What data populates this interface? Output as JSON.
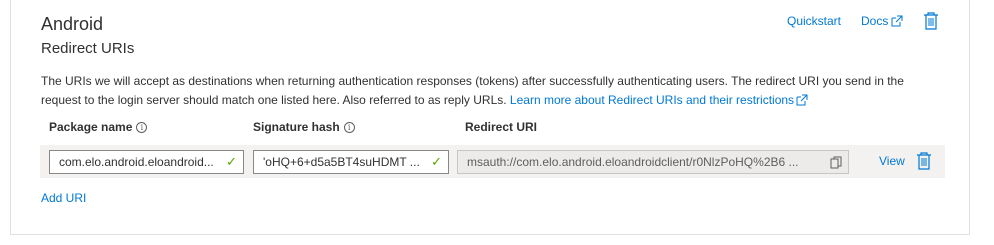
{
  "platform": {
    "title": "Android",
    "subtitle": "Redirect URIs"
  },
  "links": {
    "quickstart": "Quickstart",
    "docs": "Docs"
  },
  "description": {
    "text": "The URIs we will accept as destinations when returning authentication responses (tokens) after successfully authenticating users. The redirect URI you send in the request to the login server should match one listed here. Also referred to as reply URLs.",
    "link": "Learn more about Redirect URIs and their restrictions"
  },
  "columns": {
    "package_name": "Package name",
    "signature_hash": "Signature hash",
    "redirect_uri": "Redirect URI"
  },
  "row": {
    "package_name": "com.elo.android.eloandroid...",
    "signature_hash": "'oHQ+6+d5a5BT4suHDMT ...",
    "redirect_uri": "msauth://com.elo.android.eloandroidclient/r0NlzPoHQ%2B6 ...",
    "view_label": "View"
  },
  "add_uri_label": "Add URI",
  "colors": {
    "accent": "#0078d4",
    "success": "#57a300",
    "text": "#323130"
  }
}
